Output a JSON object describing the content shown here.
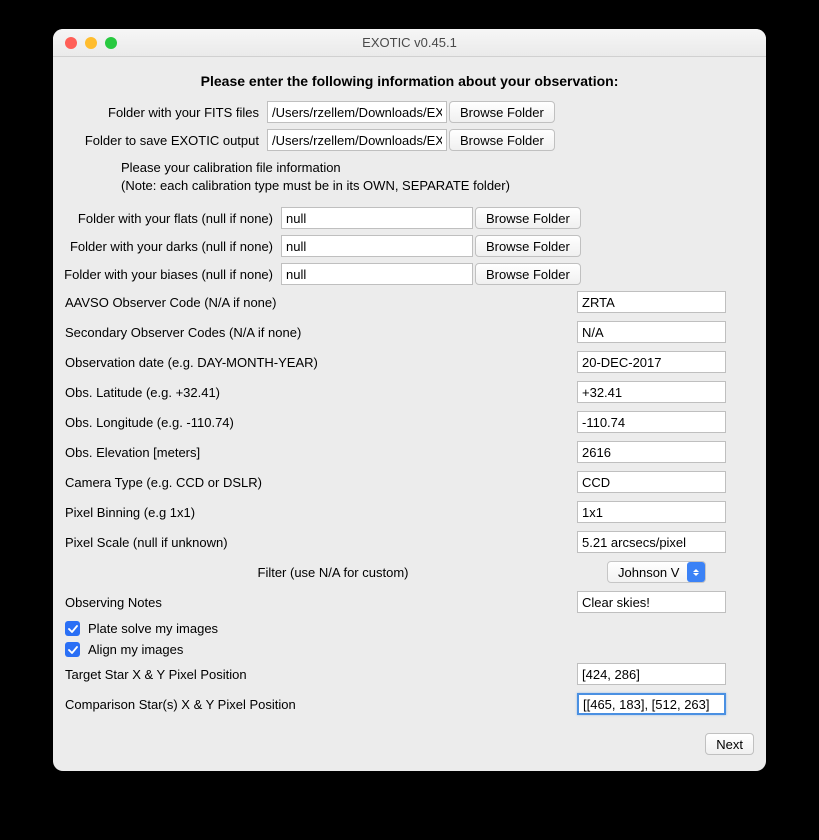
{
  "window": {
    "title": "EXOTIC v0.45.1"
  },
  "heading": "Please enter the following information about your observation:",
  "folders": {
    "fits": {
      "label": "Folder with your FITS files",
      "value": "/Users/rzellem/Downloads/EXOTIC_example"
    },
    "output": {
      "label": "Folder to save EXOTIC output",
      "value": "/Users/rzellem/Downloads/EXOTIC_output"
    }
  },
  "note": {
    "line1": "Please your calibration file information",
    "line2": "(Note: each calibration type must be in its OWN, SEPARATE folder)"
  },
  "calib": {
    "flats": {
      "label": "Folder with your flats (null if none)",
      "value": "null"
    },
    "darks": {
      "label": "Folder with your darks (null if none)",
      "value": "null"
    },
    "biases": {
      "label": "Folder with your biases (null if none)",
      "value": "null"
    }
  },
  "browse_label": "Browse Folder",
  "fields": {
    "aavso": {
      "label": "AAVSO Observer Code (N/A if none)",
      "value": "ZRTA"
    },
    "sec": {
      "label": "Secondary Observer Codes (N/A if none)",
      "value": "N/A"
    },
    "date": {
      "label": "Observation date (e.g. DAY-MONTH-YEAR)",
      "value": "20-DEC-2017"
    },
    "lat": {
      "label": "Obs. Latitude (e.g. +32.41)",
      "value": "+32.41"
    },
    "lon": {
      "label": "Obs. Longitude (e.g. -110.74)",
      "value": "-110.74"
    },
    "elev": {
      "label": "Obs. Elevation [meters]",
      "value": "2616"
    },
    "cam": {
      "label": "Camera Type (e.g. CCD or DSLR)",
      "value": "CCD"
    },
    "bin": {
      "label": "Pixel Binning  (e.g 1x1)",
      "value": "1x1"
    },
    "scale": {
      "label": "Pixel Scale (null if unknown)",
      "value": "5.21 arcsecs/pixel"
    },
    "notes": {
      "label": "Observing Notes",
      "value": "Clear skies!"
    },
    "target": {
      "label": "Target Star X & Y Pixel Position",
      "value": "[424, 286]"
    },
    "comp": {
      "label": "Comparison Star(s) X & Y Pixel Position",
      "value": "[[465, 183], [512, 263]"
    }
  },
  "filter": {
    "label": "Filter (use N/A for custom)",
    "value": "Johnson V"
  },
  "checks": {
    "plate": {
      "label": "Plate solve my images"
    },
    "align": {
      "label": "Align my images"
    }
  },
  "next_label": "Next"
}
